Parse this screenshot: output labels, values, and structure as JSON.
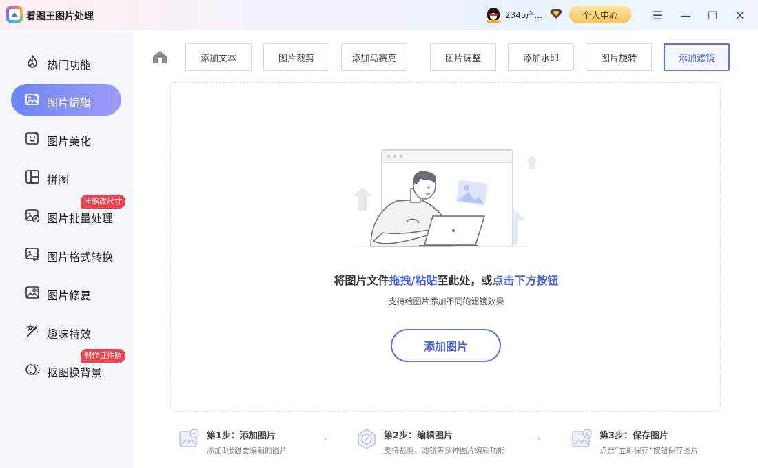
{
  "app": {
    "title": "看图王图片处理",
    "username": "2345产...",
    "user_center_label": "个人中心"
  },
  "window": {
    "menu_symbol": "☰",
    "minimize_symbol": "—",
    "maximize_symbol": "☐",
    "close_symbol": "✕"
  },
  "sidebar": {
    "items": [
      {
        "label": "热门功能",
        "icon": "flame-icon"
      },
      {
        "label": "图片编辑",
        "icon": "image-edit-icon",
        "active": true
      },
      {
        "label": "图片美化",
        "icon": "image-beautify-icon"
      },
      {
        "label": "拼图",
        "icon": "collage-icon"
      },
      {
        "label": "图片批量处理",
        "icon": "batch-image-icon",
        "badge": "压缩改尺寸"
      },
      {
        "label": "图片格式转换",
        "icon": "format-convert-icon"
      },
      {
        "label": "图片修复",
        "icon": "hd-repair-icon"
      },
      {
        "label": "趣味特效",
        "icon": "magic-wand-icon"
      },
      {
        "label": "抠图换背景",
        "icon": "cutout-icon",
        "badge": "制作证件照"
      }
    ]
  },
  "toolbar": {
    "tabs": [
      {
        "label": "添加文本"
      },
      {
        "label": "图片裁剪"
      },
      {
        "label": "添加马赛克"
      },
      {
        "label": "图片调整"
      },
      {
        "label": "添加水印"
      },
      {
        "label": "图片旋转"
      },
      {
        "label": "添加滤镜",
        "active": true
      }
    ]
  },
  "dropzone": {
    "text_part1": "将图片文件",
    "text_highlight1": "拖拽/粘贴",
    "text_part2": "至此处，或",
    "text_highlight2": "点击下方按钮",
    "subtext": "支持给图片添加不同的滤镜效果",
    "add_button_label": "添加图片"
  },
  "steps": [
    {
      "title": "第1步：添加图片",
      "desc": "添加1张想要编辑的图片"
    },
    {
      "title": "第2步：编辑图片",
      "desc": "支持裁剪、滤镜等多种图片编辑功能"
    },
    {
      "title": "第3步：保存图片",
      "desc": "点击”立即保存“按钮保存图片"
    }
  ],
  "colors": {
    "accent": "#4a63e0",
    "badge": "#f0434f",
    "active_nav_start": "#6b86f5",
    "active_nav_end": "#9f9cf6"
  }
}
